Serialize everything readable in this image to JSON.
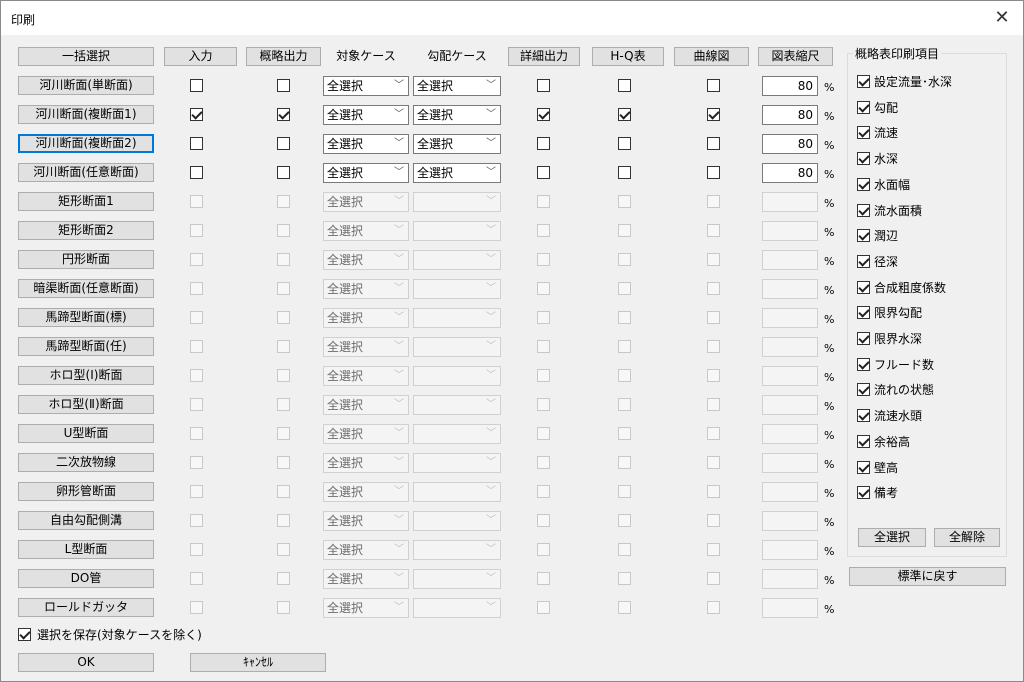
{
  "window": {
    "title": "印刷"
  },
  "headers": {
    "select_all": "一括選択",
    "input": "入力",
    "summary_output": "概略出力",
    "target_case": "対象ケース",
    "slope_case": "勾配ケース",
    "detail_output": "詳細出力",
    "hq_table": "H-Q表",
    "curve_chart": "曲線図",
    "scale": "図表縮尺"
  },
  "rows": [
    {
      "name": "河川断面(単断面)",
      "enabled": true,
      "input": false,
      "summary": false,
      "case": "全選択",
      "slope": "全選択",
      "detail": false,
      "hq": false,
      "curve": false,
      "scale": "80"
    },
    {
      "name": "河川断面(複断面1)",
      "enabled": true,
      "input": true,
      "summary": true,
      "case": "全選択",
      "slope": "全選択",
      "detail": true,
      "hq": true,
      "curve": true,
      "scale": "80"
    },
    {
      "name": "河川断面(複断面2)",
      "enabled": true,
      "input": false,
      "summary": false,
      "case": "全選択",
      "slope": "全選択",
      "detail": false,
      "hq": false,
      "curve": false,
      "scale": "80"
    },
    {
      "name": "河川断面(任意断面)",
      "enabled": true,
      "input": false,
      "summary": false,
      "case": "全選択",
      "slope": "全選択",
      "detail": false,
      "hq": false,
      "curve": false,
      "scale": "80"
    },
    {
      "name": "矩形断面1",
      "enabled": false,
      "case": "全選択",
      "slope": "",
      "scale": ""
    },
    {
      "name": "矩形断面2",
      "enabled": false,
      "case": "全選択",
      "slope": "",
      "scale": ""
    },
    {
      "name": "円形断面",
      "enabled": false,
      "case": "全選択",
      "slope": "",
      "scale": ""
    },
    {
      "name": "暗渠断面(任意断面)",
      "enabled": false,
      "case": "全選択",
      "slope": "",
      "scale": ""
    },
    {
      "name": "馬蹄型断面(標)",
      "enabled": false,
      "case": "全選択",
      "slope": "",
      "scale": ""
    },
    {
      "name": "馬蹄型断面(任)",
      "enabled": false,
      "case": "全選択",
      "slope": "",
      "scale": ""
    },
    {
      "name": "ホロ型(Ⅰ)断面",
      "enabled": false,
      "case": "全選択",
      "slope": "",
      "scale": ""
    },
    {
      "name": "ホロ型(Ⅱ)断面",
      "enabled": false,
      "case": "全選択",
      "slope": "",
      "scale": ""
    },
    {
      "name": "U型断面",
      "enabled": false,
      "case": "全選択",
      "slope": "",
      "scale": ""
    },
    {
      "name": "二次放物線",
      "enabled": false,
      "case": "全選択",
      "slope": "",
      "scale": ""
    },
    {
      "name": "卵形管断面",
      "enabled": false,
      "case": "全選択",
      "slope": "",
      "scale": ""
    },
    {
      "name": "自由勾配側溝",
      "enabled": false,
      "case": "全選択",
      "slope": "",
      "scale": ""
    },
    {
      "name": "L型断面",
      "enabled": false,
      "case": "全選択",
      "slope": "",
      "scale": ""
    },
    {
      "name": "DO管",
      "enabled": false,
      "case": "全選択",
      "slope": "",
      "scale": ""
    },
    {
      "name": "ロールドガッタ",
      "enabled": false,
      "case": "全選択",
      "slope": "",
      "scale": ""
    }
  ],
  "percent_sign": "%",
  "summary_group": {
    "title": "概略表印刷項目",
    "items": [
      {
        "label": "設定流量･水深",
        "checked": true
      },
      {
        "label": "勾配",
        "checked": true
      },
      {
        "label": "流速",
        "checked": true
      },
      {
        "label": "水深",
        "checked": true
      },
      {
        "label": "水面幅",
        "checked": true
      },
      {
        "label": "流水面積",
        "checked": true
      },
      {
        "label": "潤辺",
        "checked": true
      },
      {
        "label": "径深",
        "checked": true
      },
      {
        "label": "合成粗度係数",
        "checked": true
      },
      {
        "label": "限界勾配",
        "checked": true
      },
      {
        "label": "限界水深",
        "checked": true
      },
      {
        "label": "フルード数",
        "checked": true
      },
      {
        "label": "流れの状態",
        "checked": true
      },
      {
        "label": "流速水頭",
        "checked": true
      },
      {
        "label": "余裕高",
        "checked": true
      },
      {
        "label": "壁高",
        "checked": true
      },
      {
        "label": "備考",
        "checked": true
      }
    ],
    "select_all": "全選択",
    "clear_all": "全解除"
  },
  "reset_button": "標準に戻す",
  "save_selection": {
    "label": "選択を保存(対象ケースを除く)",
    "checked": true
  },
  "ok": "OK",
  "cancel": "ｷｬﾝｾﾙ",
  "icons": {
    "close": "close-icon",
    "dropdown": "chevron-down-icon"
  }
}
